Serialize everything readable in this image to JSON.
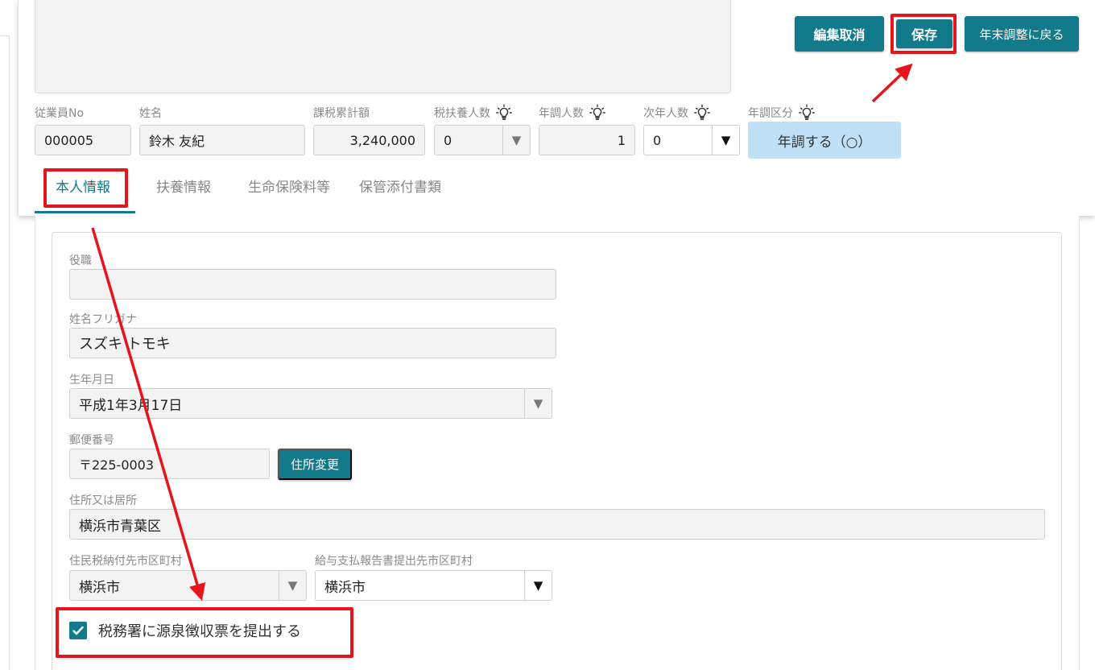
{
  "header": {
    "buttons": {
      "cancel_label": "編集取消",
      "save_label": "保存",
      "back_label": "年末調整に戻る"
    },
    "fields": {
      "employee_no": {
        "label": "従業員No",
        "value": "000005"
      },
      "name": {
        "label": "姓名",
        "value": "鈴木 友紀"
      },
      "taxable_total": {
        "label": "課税累計額",
        "value": "3,240,000"
      },
      "tax_dependents": {
        "label": "税扶養人数",
        "value": "0"
      },
      "nencho_count": {
        "label": "年調人数",
        "value": "1"
      },
      "next_year_count": {
        "label": "次年人数",
        "value": "0"
      },
      "nencho_type": {
        "label": "年調区分",
        "value": "年調する（○）"
      }
    }
  },
  "tabs": [
    {
      "label": "本人情報",
      "active": true
    },
    {
      "label": "扶養情報",
      "active": false
    },
    {
      "label": "生命保険料等",
      "active": false
    },
    {
      "label": "保管添付書類",
      "active": false
    }
  ],
  "personal": {
    "position": {
      "label": "役職",
      "value": ""
    },
    "furigana": {
      "label": "姓名フリガナ",
      "value": "スズキ トモキ"
    },
    "birthdate": {
      "label": "生年月日",
      "value": "平成1年3月17日"
    },
    "postal": {
      "label": "郵便番号",
      "value": "〒225-0003"
    },
    "address_change_label": "住所変更",
    "address": {
      "label": "住所又は居所",
      "value": "横浜市青葉区"
    },
    "resident_tax_city": {
      "label": "住民税納付先市区町村",
      "value": "横浜市"
    },
    "salary_report_city": {
      "label": "給与支払報告書提出先市区町村",
      "value": "横浜市"
    },
    "submit_withholding": {
      "label": "税務署に源泉徴収票を提出する",
      "checked": true
    }
  },
  "colors": {
    "accent": "#127a8a",
    "highlight": "#e8141c",
    "badge": "#bfe0f6"
  }
}
